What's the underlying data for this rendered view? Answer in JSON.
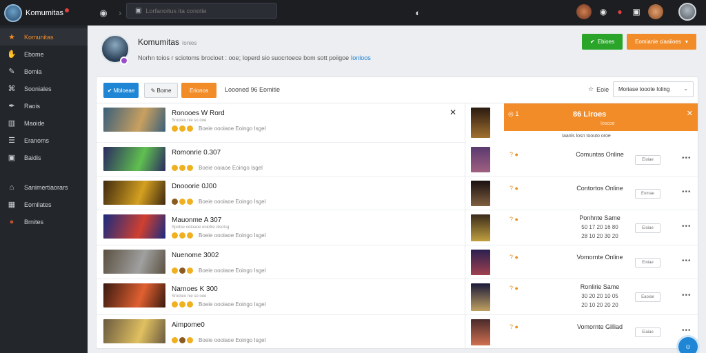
{
  "topbar": {
    "app_name": "Komumitas",
    "search_placeholder": "Lorfanoitus ita conotie"
  },
  "sidebar": {
    "items": [
      {
        "label": "Komunitas",
        "icon": "star-icon",
        "active": true
      },
      {
        "label": "Ebome",
        "icon": "hand-icon"
      },
      {
        "label": "Bomia",
        "icon": "pen-icon"
      },
      {
        "label": "Sooniales",
        "icon": "network-icon"
      },
      {
        "label": "Raois",
        "icon": "feather-icon"
      },
      {
        "label": "Maoide",
        "icon": "chart-icon"
      },
      {
        "label": "Eranoms",
        "icon": "list-icon"
      },
      {
        "label": "Baidis",
        "icon": "bag-icon"
      },
      {
        "label": "Sanimertiaorars",
        "icon": "home-icon"
      },
      {
        "label": "Eomilates",
        "icon": "grid-icon"
      },
      {
        "label": "Brnites",
        "icon": "avatar-icon"
      }
    ]
  },
  "header": {
    "title": "Komumitas",
    "subtitle": "Ionies",
    "description": "Norhn toios r sciotoms brocloet : ooe; Ioperd sio suocrtoece bom sott poiigoe",
    "description_link": "Ionloos",
    "green_button": "Ebioes",
    "orange_button": "Eomianie ciaaiioes"
  },
  "toolbar": {
    "tabs": [
      "Mbloeae",
      "Bome",
      "Erionos"
    ],
    "count_text": "Loooned  96 Eomitie",
    "sort_label": "Eoie",
    "sort_value": "Moriase tooote Ioling"
  },
  "left_rows": [
    {
      "title": "Ronooes W Rord",
      "sub": "Srooteo nie so ooe",
      "meta": "Boeie oooiaoe Eoingo Isgel",
      "thumb": [
        "#3a5f7a",
        "#c9a060"
      ],
      "coins": [
        "y",
        "y",
        "y"
      ]
    },
    {
      "title": "Romonrie 0.307",
      "sub": "",
      "meta": "Boeie ooiaoe Eoingo Isgel",
      "thumb": [
        "#2a2a60",
        "#60c050"
      ],
      "coins": [
        "y",
        "y",
        "y"
      ]
    },
    {
      "title": "Dnooorie 0J00",
      "sub": "",
      "meta": "Boeie oooiaoe Eoingo Isgel",
      "thumb": [
        "#402a10",
        "#d4a020"
      ],
      "coins": [
        "d",
        "y",
        "y"
      ]
    },
    {
      "title": "Mauonme A 307",
      "sub": "Spotoe ootoaoe oniotisi olsotsg",
      "meta": "Boeie oooiaoe Eoingo Isgel",
      "thumb": [
        "#1a2a80",
        "#d04030"
      ],
      "coins": [
        "y",
        "y",
        "y"
      ]
    },
    {
      "title": "Nuenome 3002",
      "sub": "",
      "meta": "Boeie oooiaoe Eoingo Isgel",
      "thumb": [
        "#5a5040",
        "#a0a0a0"
      ],
      "coins": [
        "y",
        "d",
        "y"
      ]
    },
    {
      "title": "Narnoes K 300",
      "sub": "Srooteo nie so ooe",
      "meta": "Boeie oooiaoe Eoingo Isgel",
      "thumb": [
        "#3a1a10",
        "#e06030"
      ],
      "coins": [
        "y",
        "y",
        "y"
      ]
    },
    {
      "title": "Aimpome0",
      "sub": "",
      "meta": "Boeie oooiaoe Eoingo Isgel",
      "thumb": [
        "#6a5a40",
        "#e0c060"
      ],
      "coins": [
        "y",
        "d",
        "y"
      ]
    }
  ],
  "orange_panel": {
    "left_text": "1",
    "title": "86 Liroes",
    "status": "Ioscoe",
    "note": "Iaanls losn toouto oroe"
  },
  "right_rows": [
    {
      "label": "Comuntas Online",
      "sub1": "",
      "sub2": "",
      "button": "Eioiae",
      "thumb": [
        "#5a3a70",
        "#a06080"
      ]
    },
    {
      "label": "Contortos Online",
      "sub1": "",
      "sub2": "",
      "button": "Eomae",
      "thumb": [
        "#1a1010",
        "#806040"
      ]
    },
    {
      "label": "Ponhnte Same",
      "sub1": "50 17 20 16 80",
      "sub2": "28 10 20 30 20",
      "button": "Eioiae",
      "thumb": [
        "#3a2a1a",
        "#c0a040"
      ]
    },
    {
      "label": "Vomornte Online",
      "sub1": "",
      "sub2": "",
      "button": "Eioiae",
      "thumb": [
        "#2a2050",
        "#a04050"
      ]
    },
    {
      "label": "Ronlirie Same",
      "sub1": "30 20 20 10 05",
      "sub2": "20 10 20 20 20",
      "button": "Eaoiae",
      "thumb": [
        "#1a1a3a",
        "#c0a060"
      ]
    },
    {
      "label": "Vomornte Gilliad",
      "sub1": "",
      "sub2": "",
      "button": "Eiaiae",
      "thumb": [
        "#4a2a2a",
        "#d07050"
      ]
    }
  ],
  "colors": {
    "accent": "#f28c28",
    "primary": "#1f86d6",
    "success": "#2aa52a"
  }
}
